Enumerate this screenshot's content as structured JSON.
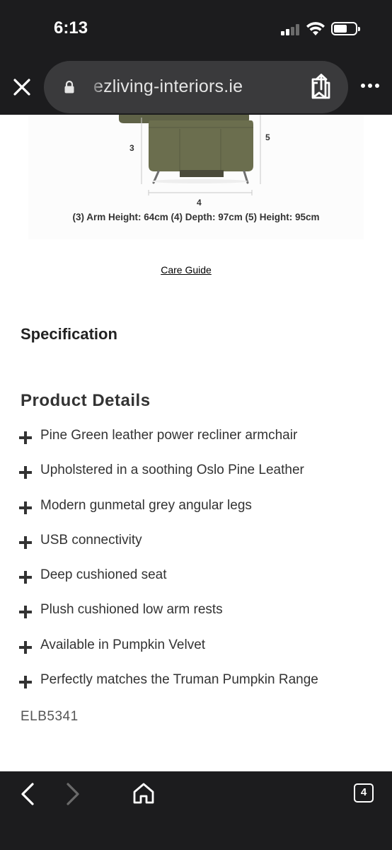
{
  "status_bar": {
    "time": "6:13"
  },
  "browser": {
    "url": "ezliving-interiors.ie",
    "tab_count": "4"
  },
  "product_image": {
    "dim_labels": {
      "arm_height": "3",
      "depth": "4",
      "height": "5"
    },
    "caption": "(3) Arm Height: 64cm (4) Depth: 97cm (5) Height: 95cm"
  },
  "care_guide_link": "Care Guide",
  "specification": {
    "title": "Specification"
  },
  "product_details": {
    "title": "Product Details",
    "items": [
      "Pine Green leather power recliner armchair",
      "Upholstered in a soothing Oslo Pine Leather",
      "Modern gunmetal grey angular legs",
      "USB connectivity",
      "Deep cushioned seat",
      "Plush cushioned low arm rests",
      "Available in Pumpkin Velvet",
      "Perfectly matches the Truman Pumpkin Range"
    ],
    "sku": "ELB5341"
  },
  "colors": {
    "chrome": "#1c1c1e",
    "url_bar": "#3a3a3c",
    "chair": "#6b6e4e"
  }
}
